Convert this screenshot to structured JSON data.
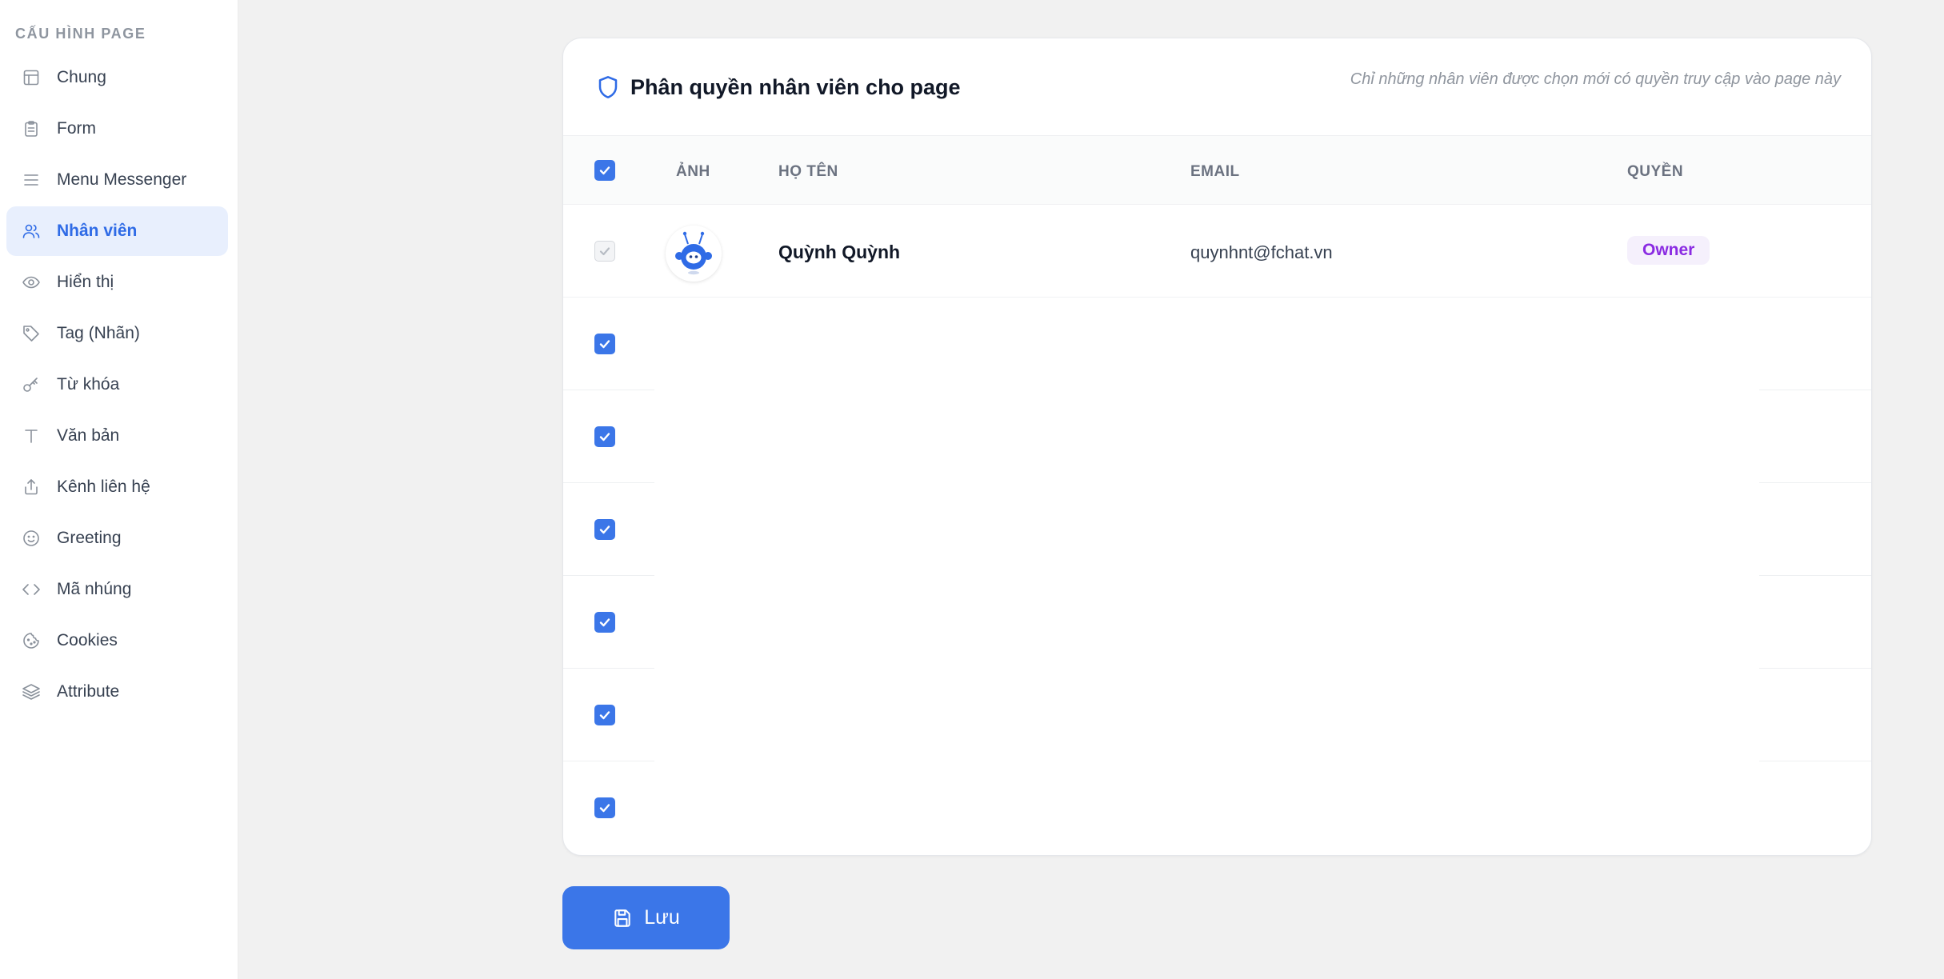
{
  "sidebar": {
    "heading": "CẤU HÌNH PAGE",
    "items": [
      {
        "label": "Chung",
        "icon": "layout-icon"
      },
      {
        "label": "Form",
        "icon": "clipboard-icon"
      },
      {
        "label": "Menu Messenger",
        "icon": "menu-icon"
      },
      {
        "label": "Nhân viên",
        "icon": "users-icon",
        "active": true
      },
      {
        "label": "Hiển thị",
        "icon": "eye-icon"
      },
      {
        "label": "Tag (Nhãn)",
        "icon": "tag-icon"
      },
      {
        "label": "Từ khóa",
        "icon": "key-icon"
      },
      {
        "label": "Văn bản",
        "icon": "text-icon"
      },
      {
        "label": "Kênh liên hệ",
        "icon": "share-icon"
      },
      {
        "label": "Greeting",
        "icon": "smile-icon"
      },
      {
        "label": "Mã nhúng",
        "icon": "code-icon"
      },
      {
        "label": "Cookies",
        "icon": "cookie-icon"
      },
      {
        "label": "Attribute",
        "icon": "layers-icon"
      }
    ]
  },
  "card": {
    "title": "Phân quyền nhân viên cho page",
    "hint": "Chỉ những nhân viên được chọn mới có quyền truy cập vào page này",
    "columns": {
      "avatar": "ẢNH",
      "name": "HỌ TÊN",
      "email": "EMAIL",
      "role": "QUYỀN"
    },
    "rows": [
      {
        "name": "Quỳnh Quỳnh",
        "email": "quynhnt@fchat.vn",
        "role": "Owner",
        "checked": true,
        "disabled": true
      }
    ],
    "empty_checked_rows": 6
  },
  "actions": {
    "save_label": "Lưu"
  },
  "colors": {
    "accent": "#3b76e8",
    "active_bg": "#e8effd",
    "owner_badge_text": "#8a2be2",
    "owner_badge_bg": "#f5f0fc"
  }
}
